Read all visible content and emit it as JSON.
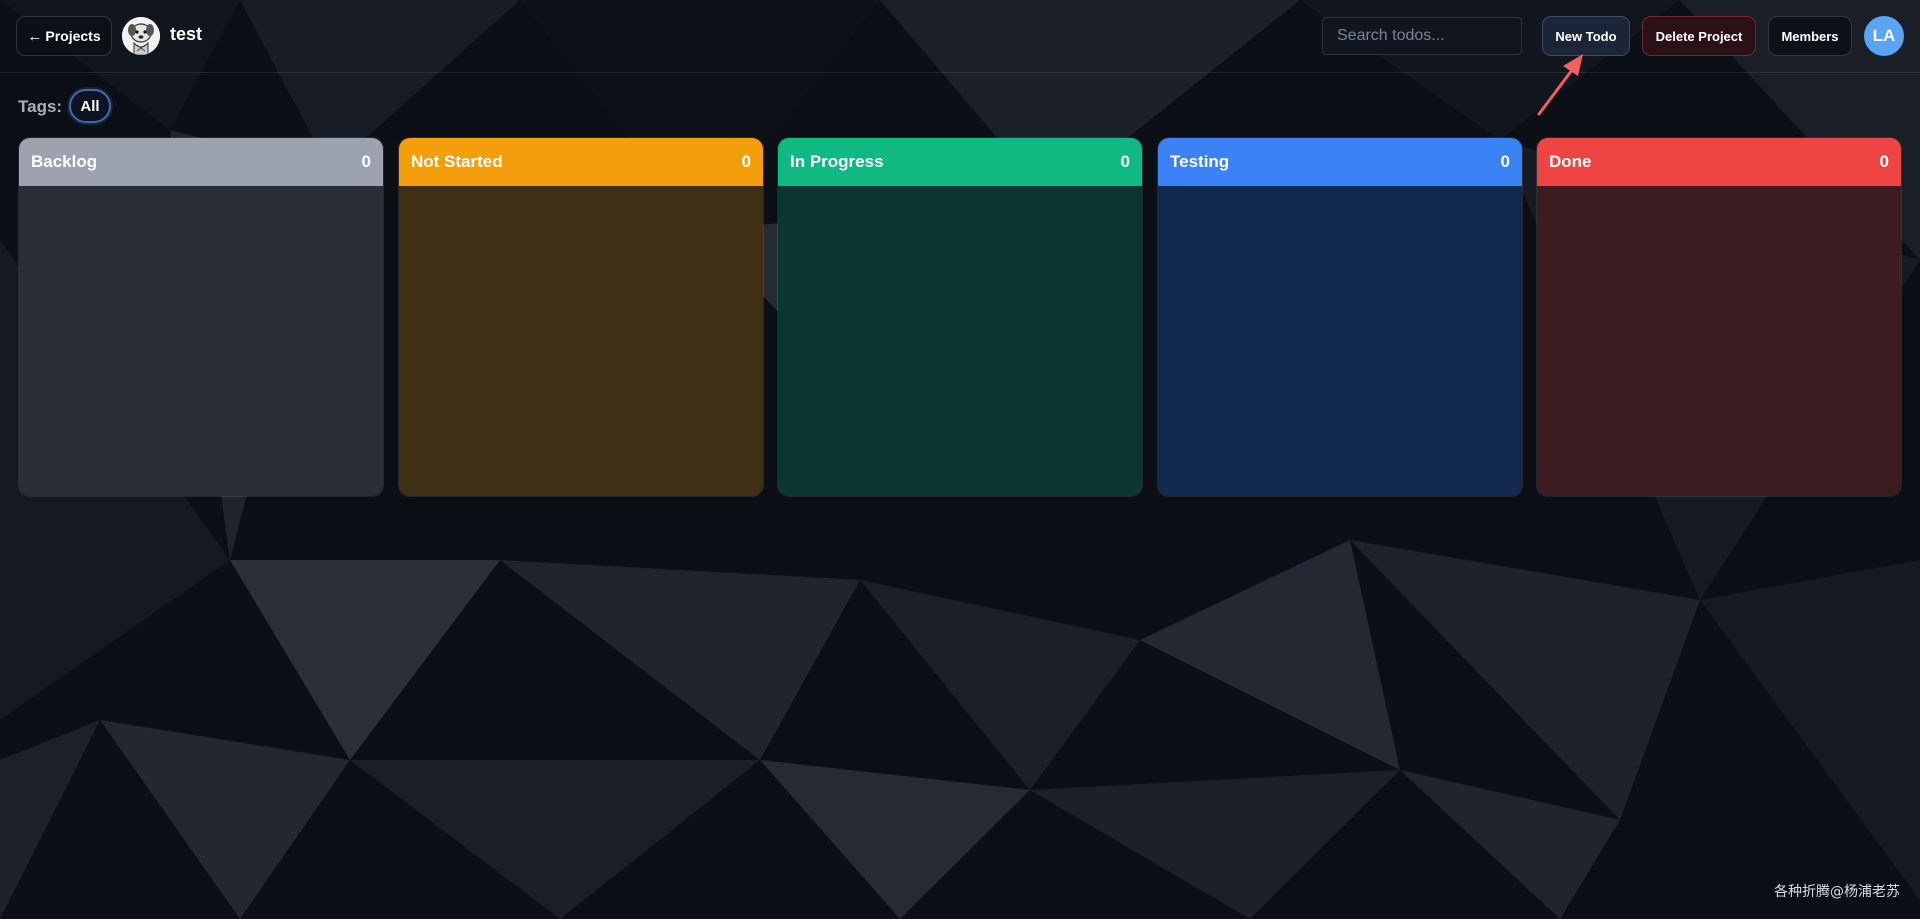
{
  "header": {
    "back_label": "Projects",
    "back_arrow": "←",
    "project_name": "test",
    "search_placeholder": "Search todos...",
    "new_todo_label": "New Todo",
    "delete_project_label": "Delete Project",
    "members_label": "Members",
    "user_initials": "LA"
  },
  "tags": {
    "label": "Tags:",
    "items": [
      "All"
    ]
  },
  "columns": [
    {
      "title": "Backlog",
      "count": "0",
      "header_color": "#9ca3af",
      "body_color": "#2a2f37"
    },
    {
      "title": "Not Started",
      "count": "0",
      "header_color": "#f59e0b",
      "body_color": "#3f3015"
    },
    {
      "title": "In Progress",
      "count": "0",
      "header_color": "#10b981",
      "body_color": "#0b3631"
    },
    {
      "title": "Testing",
      "count": "0",
      "header_color": "#3b82f6",
      "body_color": "#13284d"
    },
    {
      "title": "Done",
      "count": "0",
      "header_color": "#ef4444",
      "body_color": "#3c1c21"
    }
  ],
  "watermark": "各种折腾@杨浦老苏",
  "colors": {
    "accent_avatar": "#5aa4f5",
    "callout_arrow": "#f0605c"
  },
  "icons": {
    "project_avatar": "dog-avatar-icon",
    "callout": "red-arrow-icon"
  }
}
